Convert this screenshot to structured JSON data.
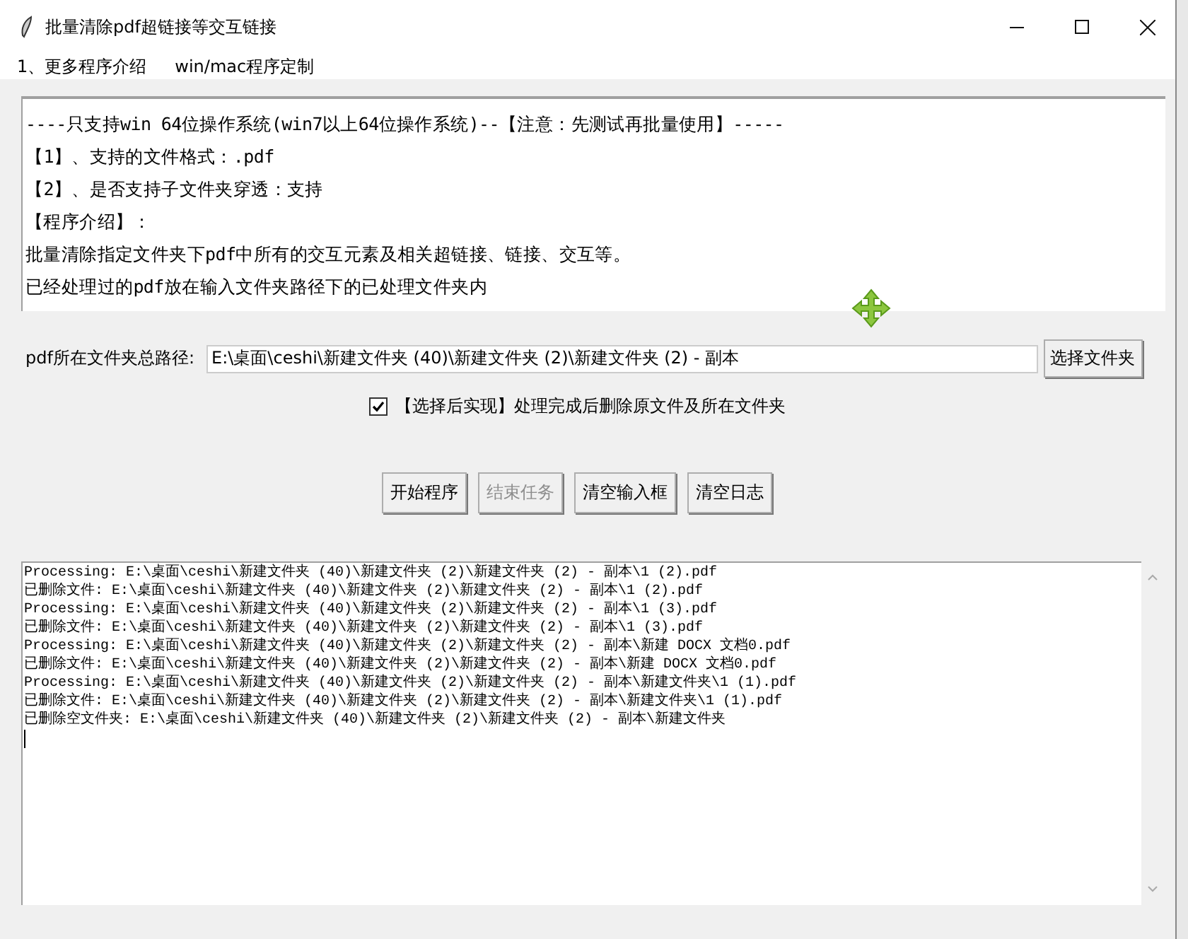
{
  "window": {
    "title": "批量清除pdf超链接等交互链接"
  },
  "menu": [
    "1、更多程序介绍",
    "win/mac程序定制"
  ],
  "info_lines": [
    "----只支持win 64位操作系统(win7以上64位操作系统)--【注意：先测试再批量使用】-----",
    "【1】、支持的文件格式：.pdf",
    "【2】、是否支持子文件夹穿透：支持",
    "【程序介绍】：",
    "批量清除指定文件夹下pdf中所有的交互元素及相关超链接、链接、交互等。",
    "已经处理过的pdf放在输入文件夹路径下的已处理文件夹内"
  ],
  "path": {
    "label": "pdf所在文件夹总路径:",
    "value": "E:\\桌面\\ceshi\\新建文件夹 (40)\\新建文件夹 (2)\\新建文件夹 (2) - 副本",
    "button": "选择文件夹"
  },
  "option": {
    "label": "【选择后实现】处理完成后删除原文件及所在文件夹",
    "checked": true
  },
  "buttons": [
    {
      "label": "开始程序",
      "disabled": false
    },
    {
      "label": "结束任务",
      "disabled": true
    },
    {
      "label": "清空输入框",
      "disabled": false
    },
    {
      "label": "清空日志",
      "disabled": false
    }
  ],
  "log": [
    "Processing: E:\\桌面\\ceshi\\新建文件夹 (40)\\新建文件夹 (2)\\新建文件夹 (2) - 副本\\1 (2).pdf",
    "已删除文件: E:\\桌面\\ceshi\\新建文件夹 (40)\\新建文件夹 (2)\\新建文件夹 (2) - 副本\\1 (2).pdf",
    "Processing: E:\\桌面\\ceshi\\新建文件夹 (40)\\新建文件夹 (2)\\新建文件夹 (2) - 副本\\1 (3).pdf",
    "已删除文件: E:\\桌面\\ceshi\\新建文件夹 (40)\\新建文件夹 (2)\\新建文件夹 (2) - 副本\\1 (3).pdf",
    "Processing: E:\\桌面\\ceshi\\新建文件夹 (40)\\新建文件夹 (2)\\新建文件夹 (2) - 副本\\新建 DOCX 文档0.pdf",
    "已删除文件: E:\\桌面\\ceshi\\新建文件夹 (40)\\新建文件夹 (2)\\新建文件夹 (2) - 副本\\新建 DOCX 文档0.pdf",
    "Processing: E:\\桌面\\ceshi\\新建文件夹 (40)\\新建文件夹 (2)\\新建文件夹 (2) - 副本\\新建文件夹\\1 (1).pdf",
    "已删除文件: E:\\桌面\\ceshi\\新建文件夹 (40)\\新建文件夹 (2)\\新建文件夹 (2) - 副本\\新建文件夹\\1 (1).pdf",
    "已删除空文件夹: E:\\桌面\\ceshi\\新建文件夹 (40)\\新建文件夹 (2)\\新建文件夹 (2) - 副本\\新建文件夹"
  ]
}
